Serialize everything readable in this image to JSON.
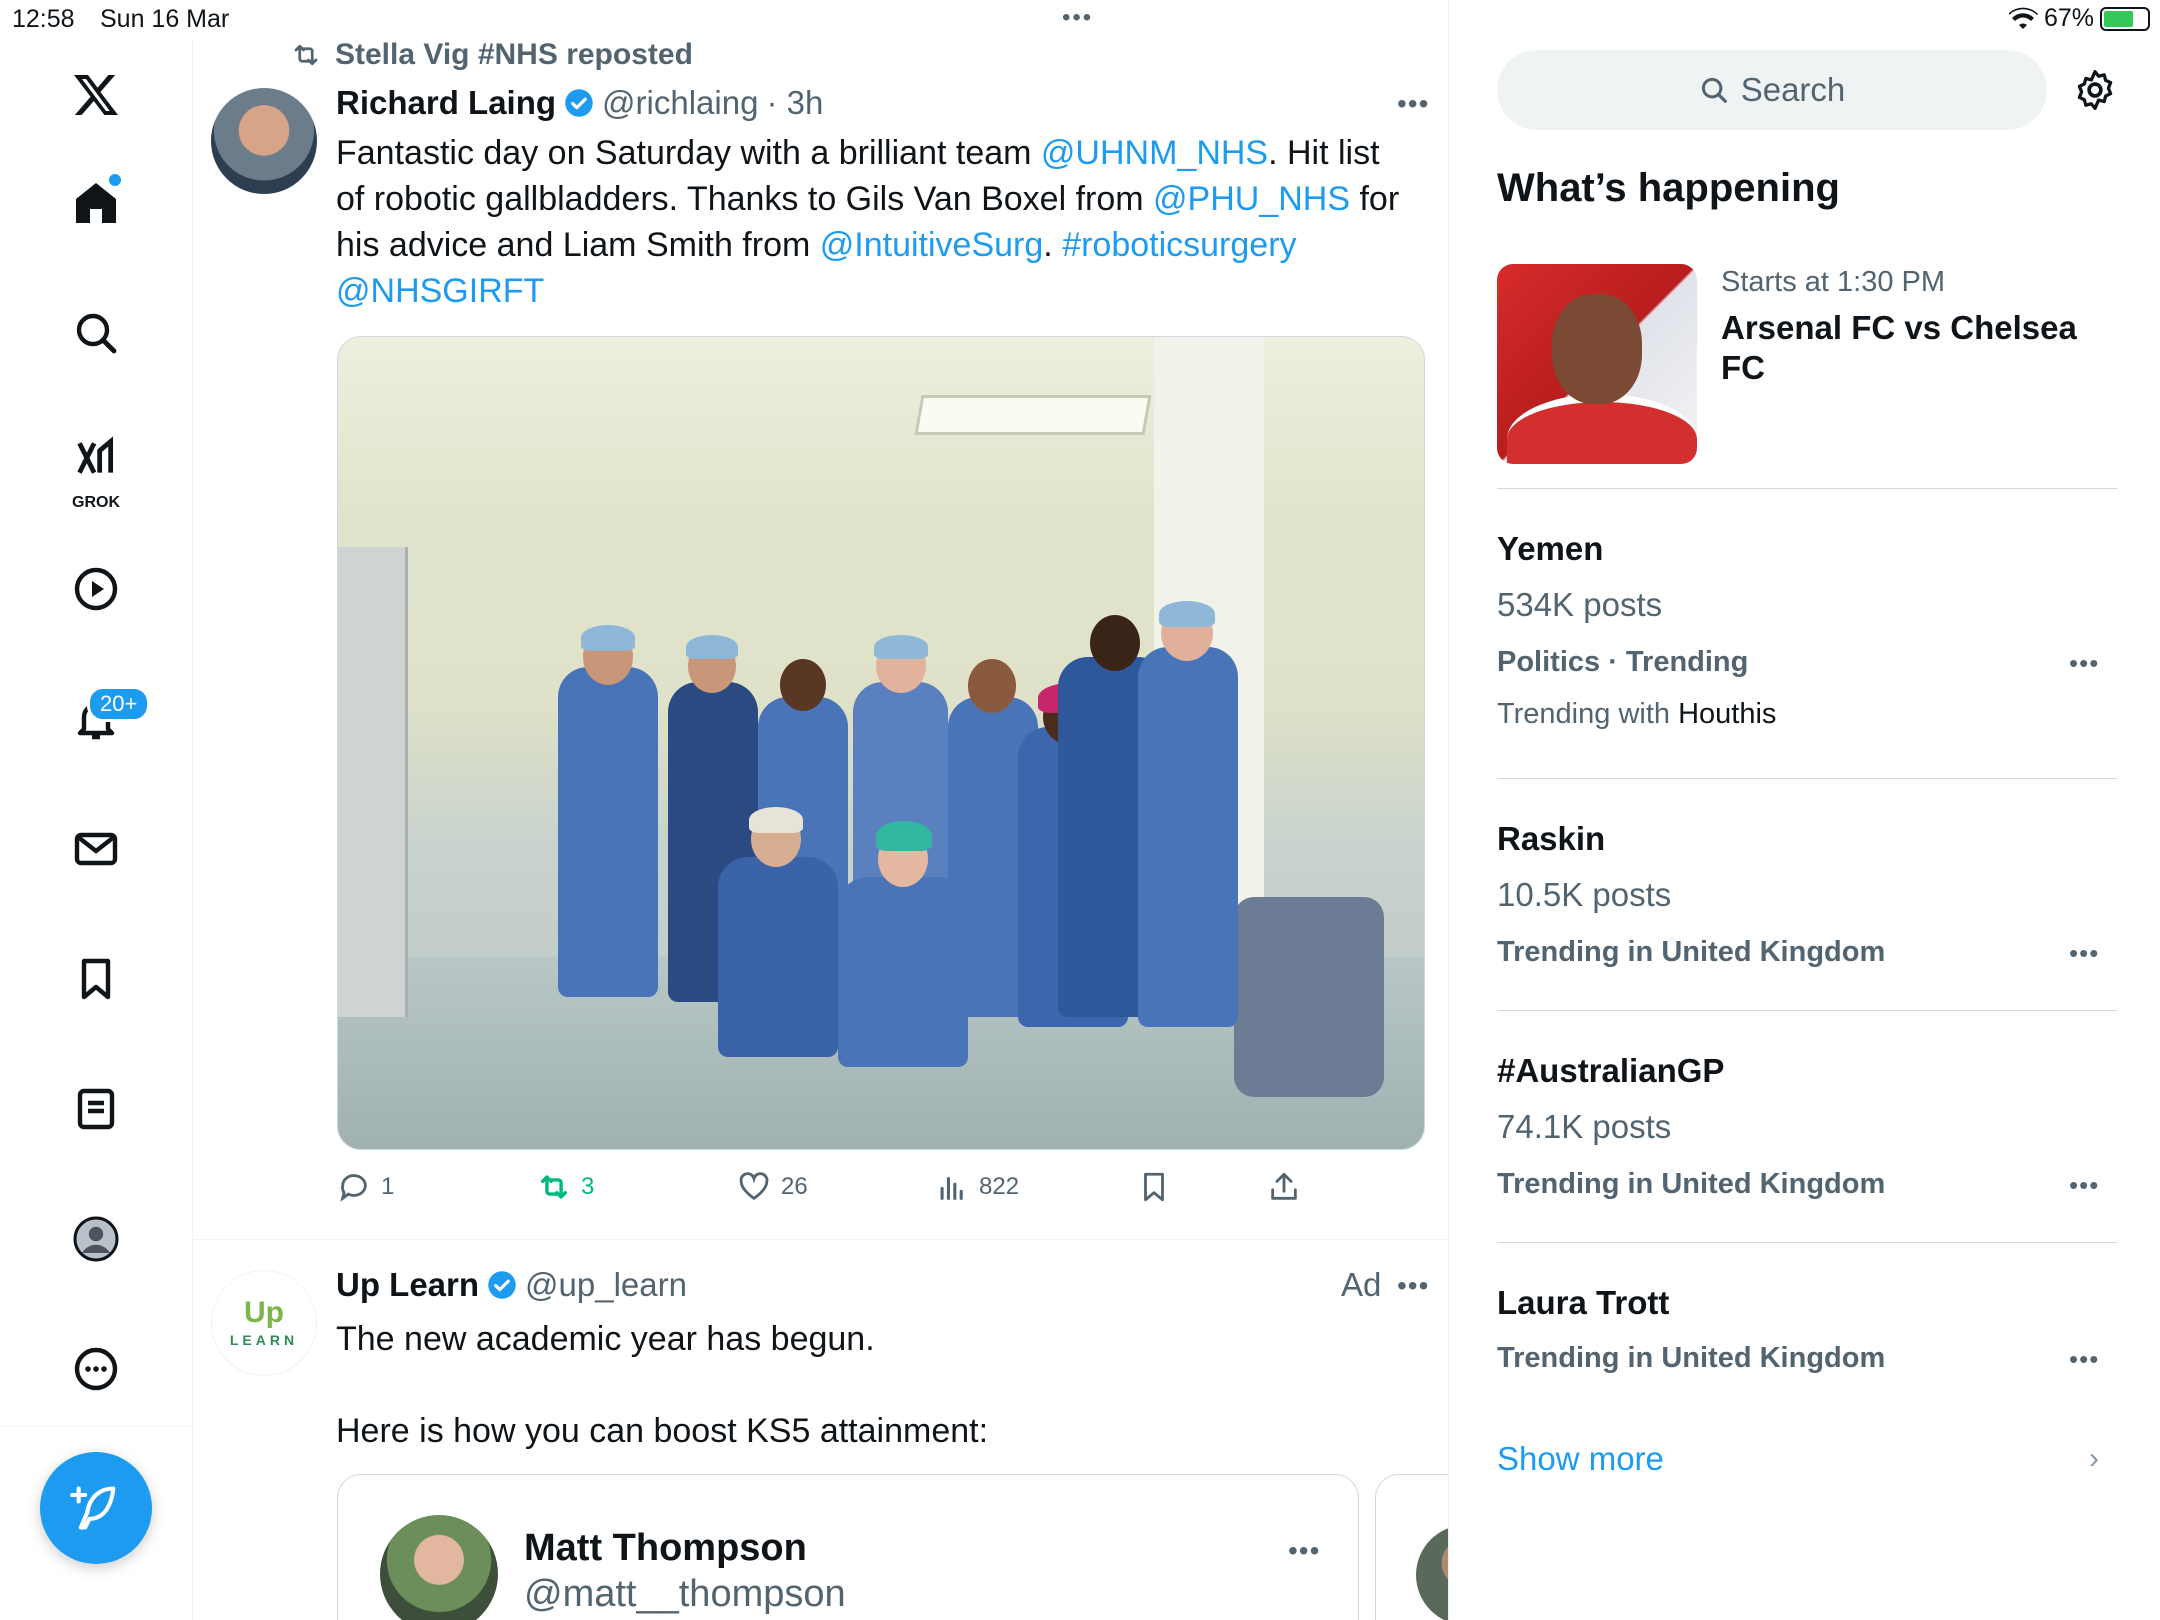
{
  "status": {
    "time": "12:58",
    "date": "Sun 16 Mar",
    "battery": "67%"
  },
  "nav": {
    "grok_label": "GROK",
    "notifications_badge": "20+",
    "items": [
      "x-logo",
      "home-icon",
      "search-icon",
      "grok-icon",
      "video-icon",
      "bell-icon",
      "mail-icon",
      "bookmark-icon",
      "lists-icon",
      "profile-icon",
      "more-icon"
    ]
  },
  "feed": {
    "tweet1": {
      "repost_label": "Stella Vig #NHS reposted",
      "name": "Richard Laing",
      "handle": "@richlaing",
      "time": "· 3h",
      "text": [
        {
          "t": "Fantastic day on Saturday with a brilliant team ",
          "link": false
        },
        {
          "t": "@UHNM_NHS",
          "link": true
        },
        {
          "t": ". Hit list of robotic gallbladders. Thanks to Gils Van Boxel from ",
          "link": false
        },
        {
          "t": "@PHU_NHS",
          "link": true
        },
        {
          "t": " for his advice and Liam Smith from ",
          "link": false
        },
        {
          "t": "@IntuitiveSurg",
          "link": true
        },
        {
          "t": ". ",
          "link": false
        },
        {
          "t": "#roboticsurgery",
          "link": true
        },
        {
          "t": " ",
          "link": false
        },
        {
          "t": "@NHSGIRFT",
          "link": true
        }
      ],
      "replies": "1",
      "reposts": "3",
      "likes": "26",
      "views": "822"
    },
    "tweet2": {
      "name": "Up Learn",
      "handle": "@up_learn",
      "ad_label": "Ad",
      "avatar_mark": "Up",
      "avatar_word": "LEARN",
      "line1": "The new academic year has begun.",
      "line2": "Here is how you can boost KS5 attainment:",
      "card": {
        "name": "Matt Thompson",
        "handle": "@matt__thompson"
      }
    }
  },
  "right": {
    "search_placeholder": "Search",
    "heading": "What’s happening",
    "event": {
      "time": "Starts at 1:30 PM",
      "title": "Arsenal FC vs Chelsea FC"
    },
    "trends": [
      {
        "title": "Yemen",
        "posts": "534K posts",
        "meta": "Politics · Trending",
        "with_prefix": "Trending with ",
        "with": "Houthis"
      },
      {
        "title": "Raskin",
        "posts": "10.5K posts",
        "meta": "Trending in United Kingdom"
      },
      {
        "title": "#AustralianGP",
        "posts": "74.1K posts",
        "meta": "Trending in United Kingdom"
      },
      {
        "title": "Laura Trott",
        "meta": "Trending in United Kingdom"
      }
    ],
    "show_more": "Show more"
  },
  "colors": {
    "accent": "#1d9bf0",
    "repost_green": "#00ba7c",
    "muted": "#536471"
  }
}
